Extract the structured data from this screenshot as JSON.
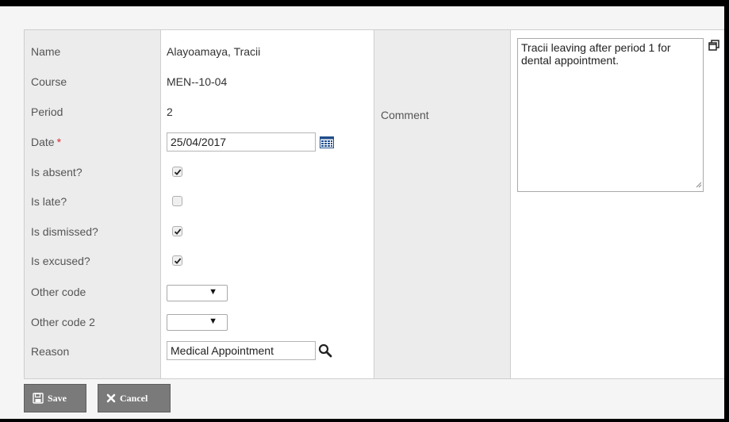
{
  "form": {
    "labels": {
      "name": "Name",
      "course": "Course",
      "period": "Period",
      "date": "Date",
      "date_required_marker": "*",
      "is_absent": "Is absent?",
      "is_late": "Is late?",
      "is_dismissed": "Is dismissed?",
      "is_excused": "Is excused?",
      "other_code": "Other code",
      "other_code_2": "Other code 2",
      "reason": "Reason",
      "comment": "Comment"
    },
    "values": {
      "name": "Alayoamaya, Tracii",
      "course": "MEN--10-04",
      "period": "2",
      "date": "25/04/2017",
      "is_absent": true,
      "is_late": false,
      "is_dismissed": true,
      "is_excused": true,
      "other_code": "",
      "other_code_2": "",
      "reason": "Medical Appointment",
      "comment": "Tracii leaving after period 1 for dental appointment."
    },
    "dropdown_arrow": "▼"
  },
  "buttons": {
    "save_label": "Save",
    "cancel_label": "Cancel"
  },
  "icons": {
    "calendar": "calendar-icon",
    "search": "search-icon",
    "expand": "expand-window-icon",
    "save": "floppy-disk-icon",
    "cancel": "x-icon"
  },
  "colors": {
    "required": "#e0262a",
    "label_bg": "#ececec",
    "button_bg": "#7a7a7a",
    "calendar": "#1f4e8c"
  }
}
